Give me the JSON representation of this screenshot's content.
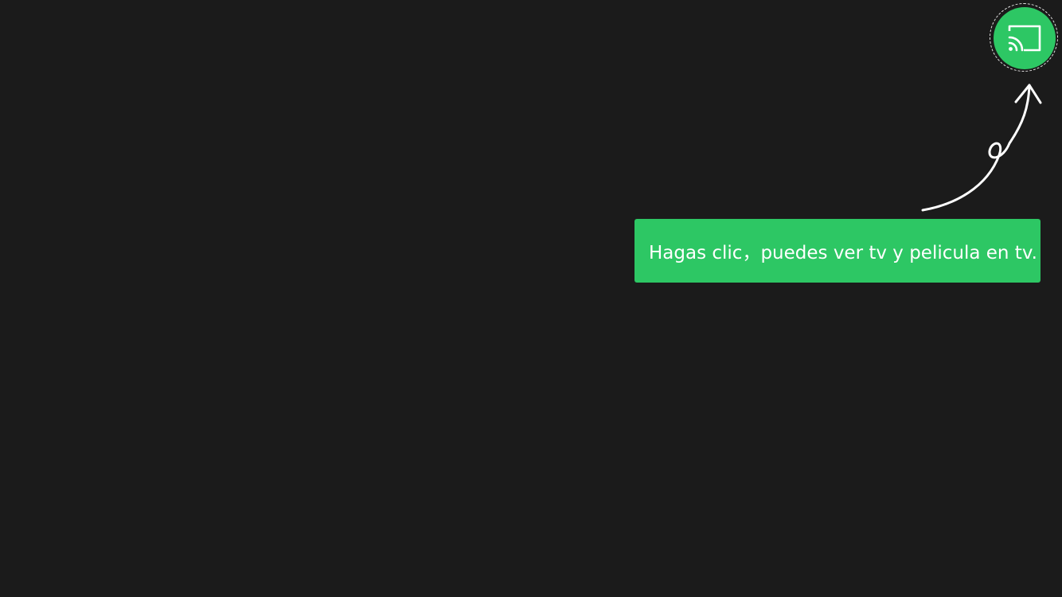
{
  "onboarding": {
    "hint_text": "Hagas clic，puedes ver tv y pelicula en tv.",
    "cast_button_icon": "cast-icon",
    "pointer_icon": "curly-arrow-icon"
  },
  "colors": {
    "background": "#1b1b1b",
    "accent_green": "#2dc764",
    "foreground": "#ffffff"
  }
}
